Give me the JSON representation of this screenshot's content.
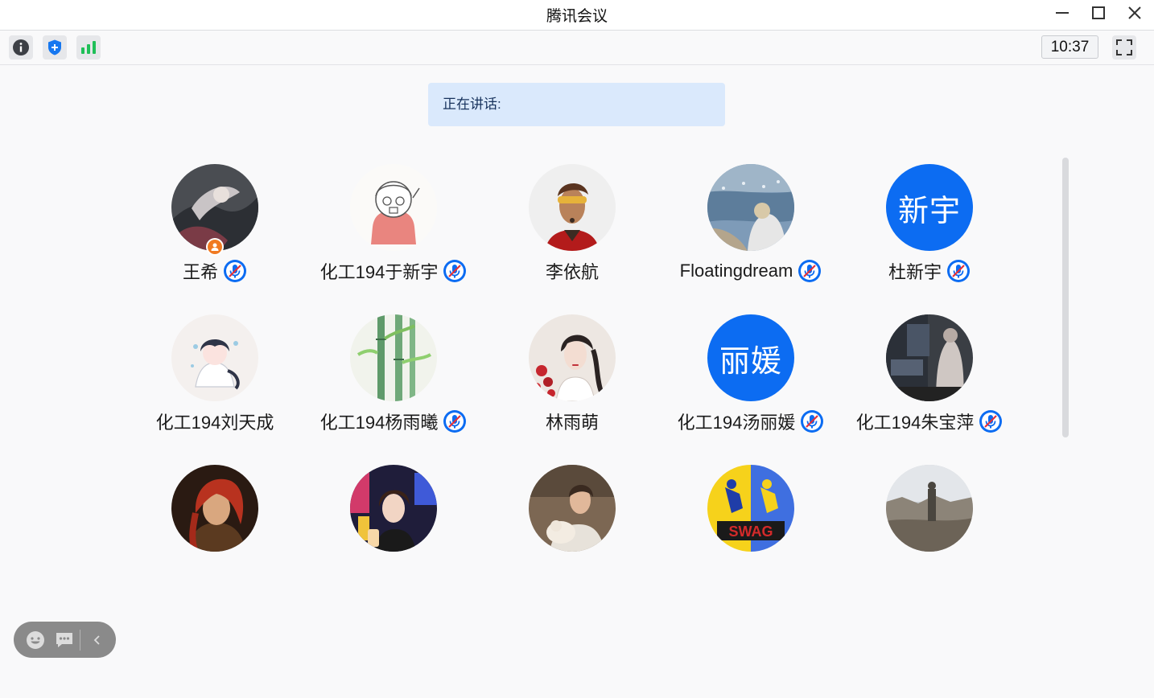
{
  "window": {
    "title": "腾讯会议"
  },
  "icons": {
    "info": "info-icon",
    "security": "shield-icon",
    "network": "signal-bars-icon",
    "fullscreen": "fullscreen-icon",
    "minimize": "minimize-icon",
    "maximize": "maximize-icon",
    "close": "close-icon",
    "emoji": "emoji-icon",
    "chat": "chat-icon",
    "collapse": "chevron-left-icon",
    "muted_mic": "muted-mic-icon",
    "host": "host-person-icon"
  },
  "toolbar": {
    "time": "10:37"
  },
  "speaking": {
    "label": "正在讲话:"
  },
  "colors": {
    "accent": "#0c6cf2",
    "banner": "#dae9fc",
    "network_green": "#1fbf58",
    "host_badge": "#f07a22"
  },
  "participants": [
    {
      "name": "王希",
      "avatar": "photo",
      "muted": true,
      "host": true
    },
    {
      "name": "化工194于新宇",
      "avatar": "photo",
      "muted": true
    },
    {
      "name": "李依航",
      "avatar": "photo",
      "muted": false
    },
    {
      "name": "Floatingdream",
      "avatar": "photo",
      "muted": true
    },
    {
      "name": "杜新宇",
      "avatar_text": "新宇",
      "muted": true
    },
    {
      "name": "化工194刘天成",
      "avatar": "photo",
      "muted": false
    },
    {
      "name": "化工194杨雨曦",
      "avatar": "photo",
      "muted": true
    },
    {
      "name": "林雨萌",
      "avatar": "photo",
      "muted": false
    },
    {
      "name": "化工194汤丽媛",
      "avatar_text": "丽媛",
      "muted": true
    },
    {
      "name": "化工194朱宝萍",
      "avatar": "photo",
      "muted": true
    },
    {
      "avatar": "photo"
    },
    {
      "avatar": "photo"
    },
    {
      "avatar": "photo"
    },
    {
      "avatar": "photo",
      "avatar_caption": "SWAG"
    },
    {
      "avatar": "photo"
    }
  ]
}
